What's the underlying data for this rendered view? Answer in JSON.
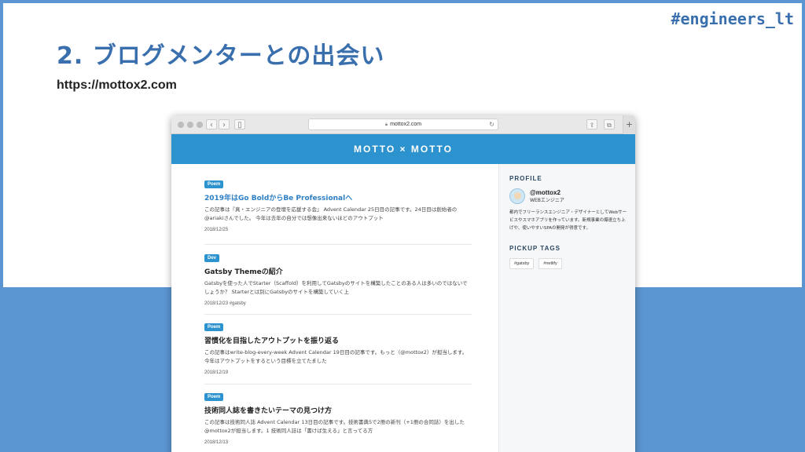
{
  "slide": {
    "title": "2. ブログメンターとの出会い",
    "url": "https://mottox2.com",
    "hashtag": "#engineers_lt"
  },
  "browser": {
    "address": "mottox2.com",
    "back_icon": "chevron-left-icon",
    "forward_icon": "chevron-right-icon",
    "sidebar_icon": "sidebar-icon",
    "share_icon": "share-icon",
    "tabs_icon": "tabs-icon",
    "new_tab_label": "+"
  },
  "site": {
    "header_title": "MOTTO × MOTTO",
    "posts": [
      {
        "tag": "Poem",
        "title": "2019年はGo BoldからBe Professionalへ",
        "excerpt": "この記事は『真・エンジニアの登壇を応援する会』 Advent Calendar 25日目の記事です。24日目は創始者の@ariakiさんでした。 今年は去年の自分では想像出来ないほどのアウトプット",
        "meta": "2018/12/25"
      },
      {
        "tag": "Dev",
        "title": "Gatsby Themeの紹介",
        "excerpt": "Gatsbyを使った人でStarter（Scaffold）を利用してGatsbyのサイトを構築したことのある人は多いのではないでしょうか？ Starterとは別にGatsbyのサイトを構築していく上",
        "meta": "2018/12/23 #gatsby"
      },
      {
        "tag": "Poem",
        "title": "習慣化を目指したアウトプットを振り返る",
        "excerpt": "この記事はwrite-blog-every-week Advent Calendar 19日目の記事です。もっと（@mottox2）が担当します。 今年はアウトプットをするという目標を立てたました",
        "meta": "2018/12/19"
      },
      {
        "tag": "Poem",
        "title": "技術同人誌を書きたいテーマの見つけ方",
        "excerpt": "この記事は技術同人誌 Advent Calendar 13日目の記事です。技術書典5で2冊の新刊（+1冊の合同誌）を出した@mottox2が担当します。1 技術同人誌は「書けば生える」と言ってる方",
        "meta": "2018/12/13"
      }
    ],
    "sidebar": {
      "profile_heading": "PROFILE",
      "profile_name": "@mottox2",
      "profile_role": "WEBエンジニア",
      "profile_bio": "都内でフリーランスエンジニア・デザイナーとしてWebサービスやスマホアプリを作っています。新規事業の爆速立ち上げや、使いやすいSPAの開発が得意です。",
      "pickup_heading": "PICKUP TAGS",
      "tags": [
        "#gatsby",
        "#netlify"
      ]
    }
  }
}
